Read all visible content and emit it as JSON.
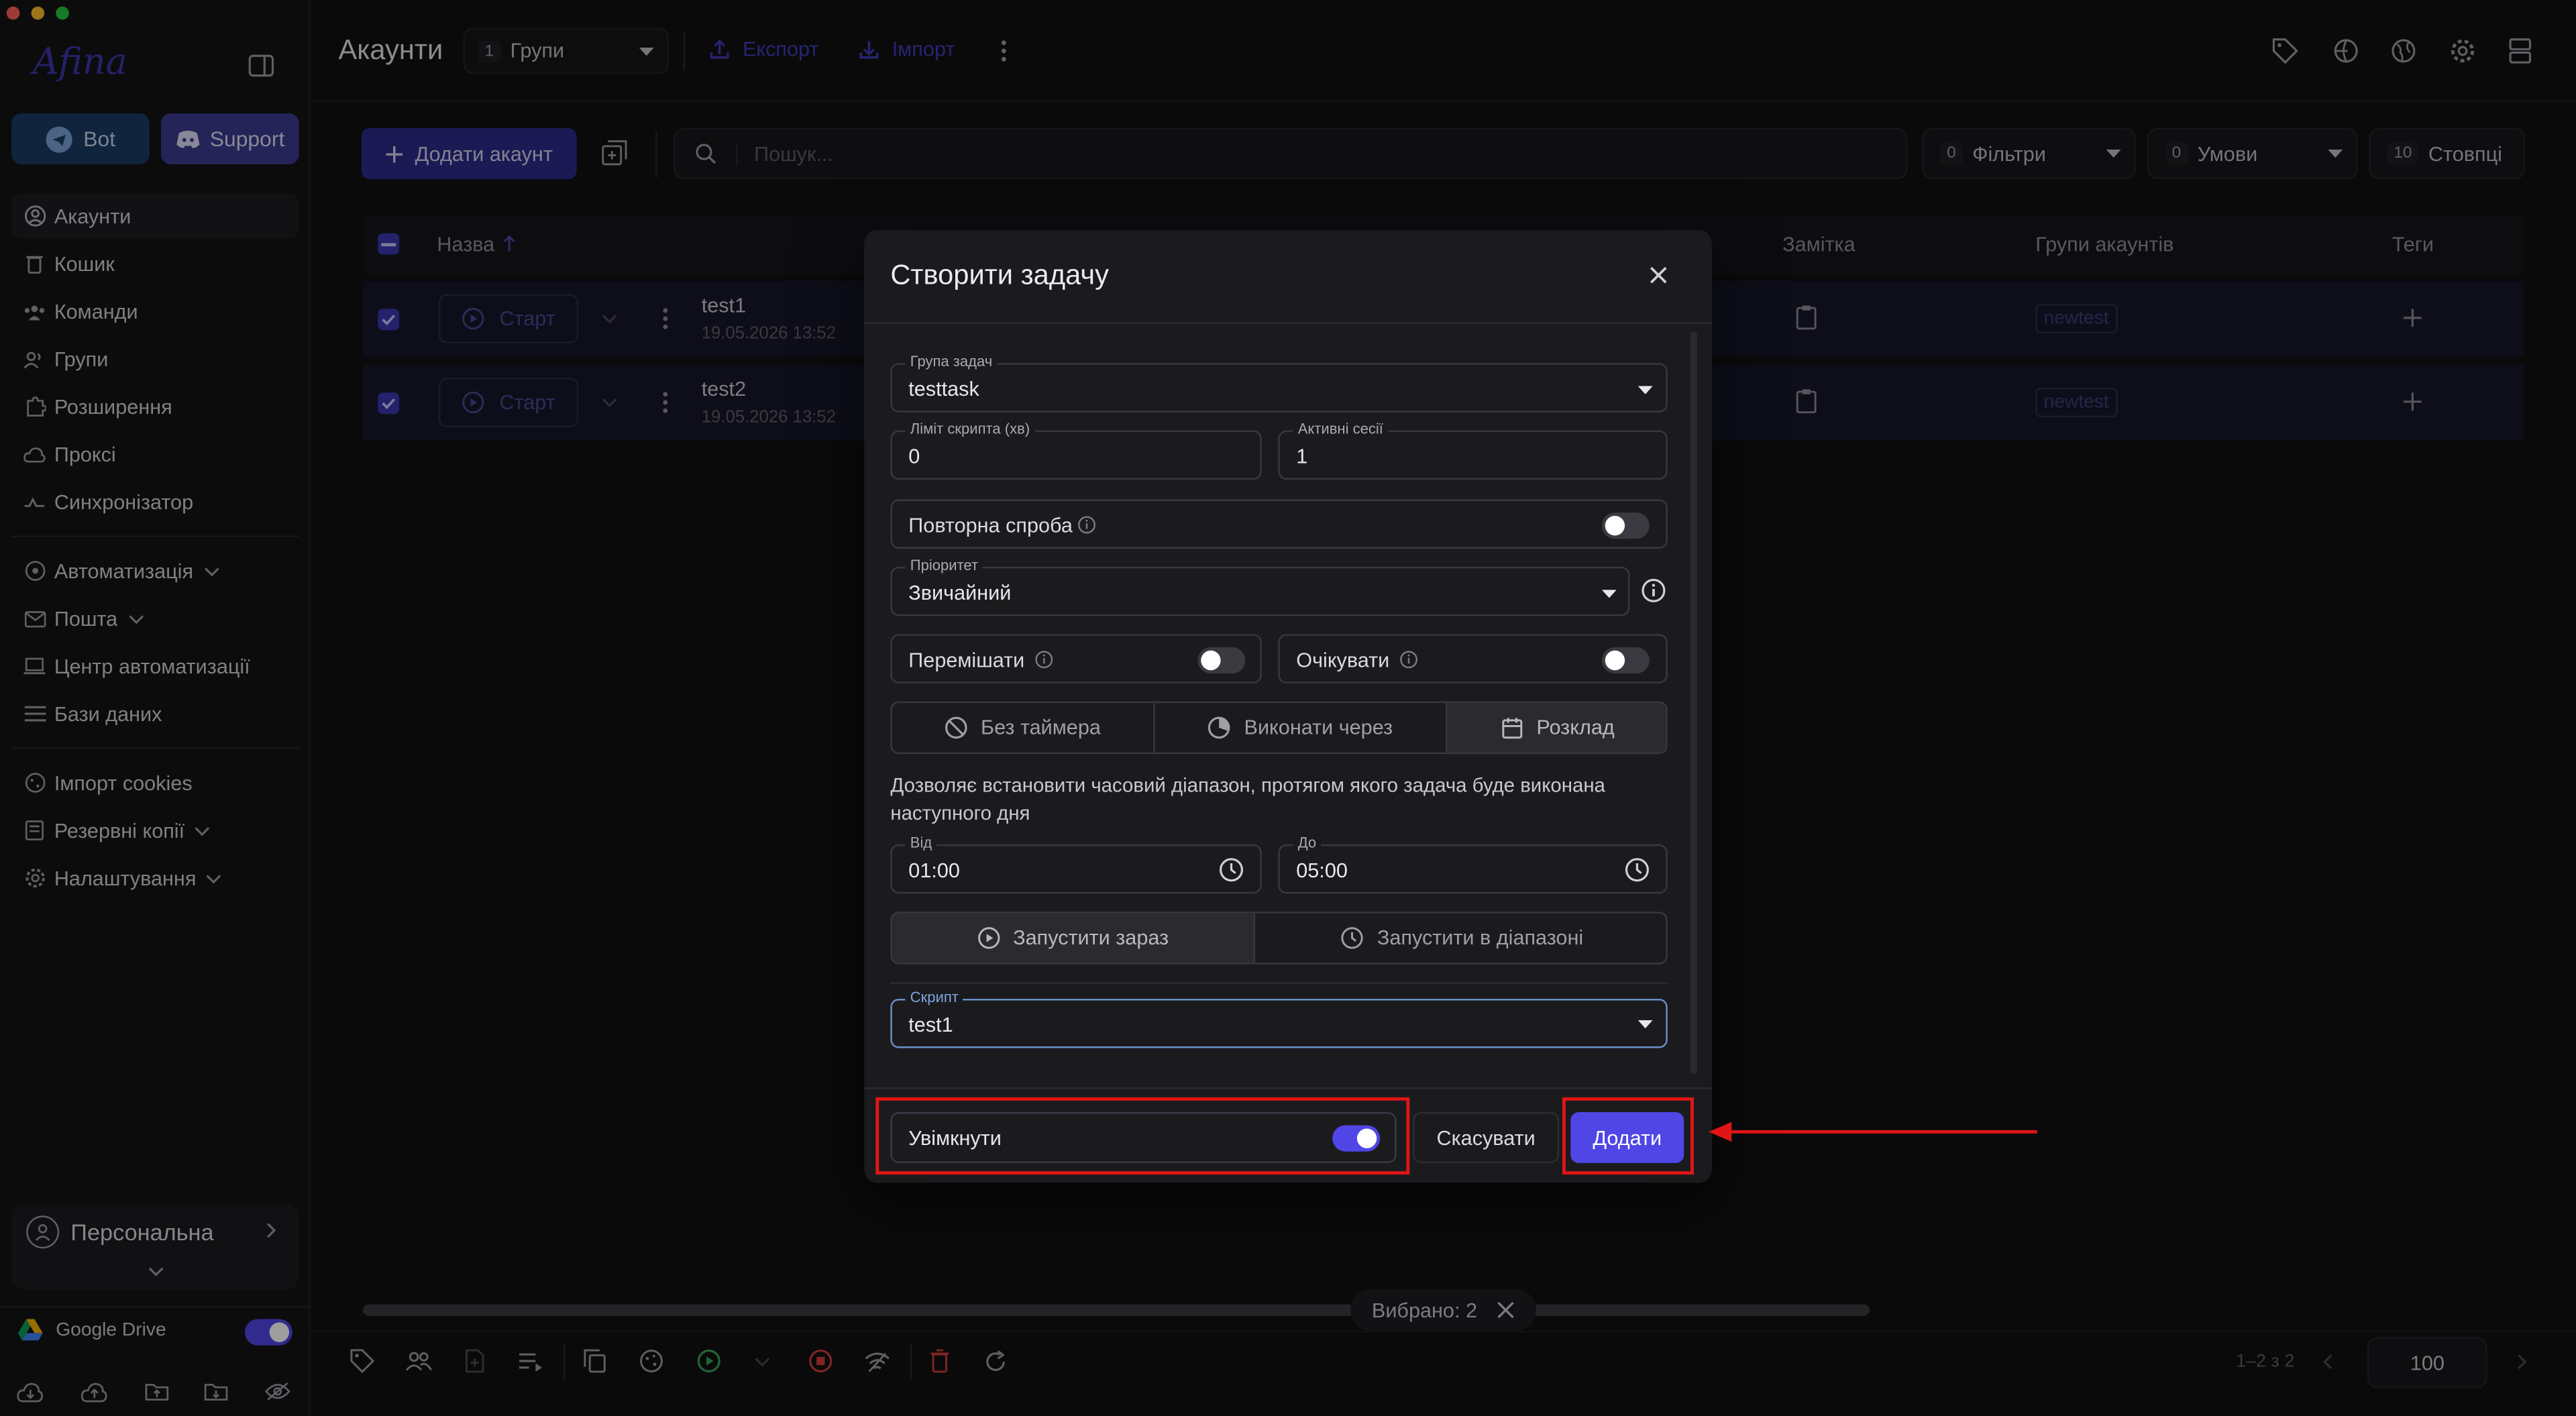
{
  "app": {
    "logo": "Afina",
    "bot_label": "Bot",
    "support_label": "Support"
  },
  "sidebar": {
    "items": [
      {
        "label": "Акаунти",
        "icon": "account-circle-icon"
      },
      {
        "label": "Кошик",
        "icon": "trash-icon"
      },
      {
        "label": "Команди",
        "icon": "team-icon"
      },
      {
        "label": "Групи",
        "icon": "group-icon"
      },
      {
        "label": "Розширення",
        "icon": "puzzle-icon"
      },
      {
        "label": "Проксі",
        "icon": "cloud-icon"
      },
      {
        "label": "Синхронізатор",
        "icon": "sync-icon"
      },
      {
        "label": "Автоматизація",
        "icon": "automation-icon"
      },
      {
        "label": "Пошта",
        "icon": "mail-icon"
      },
      {
        "label": "Центр автоматизації",
        "icon": "laptop-icon"
      },
      {
        "label": "Бази даних",
        "icon": "list-icon"
      },
      {
        "label": "Імпорт cookies",
        "icon": "cookie-icon"
      },
      {
        "label": "Резервні копії",
        "icon": "backup-icon"
      },
      {
        "label": "Налаштування",
        "icon": "gear-icon"
      }
    ],
    "profile_label": "Персональна",
    "drive_label": "Google Drive"
  },
  "topbar": {
    "title": "Акаунти",
    "groups_count": "1",
    "groups_label": "Групи",
    "export_label": "Експорт",
    "import_label": "Імпорт"
  },
  "toolbar": {
    "add_account_label": "Додати акаунт",
    "search_placeholder": "Пошук...",
    "filters_count": "0",
    "filters_label": "Фільтри",
    "conditions_count": "0",
    "conditions_label": "Умови",
    "columns_count": "10",
    "columns_label": "Стовпці"
  },
  "table": {
    "headers": {
      "name": "Назва",
      "note": "Замітка",
      "groups": "Групи акаунтів",
      "tags": "Теги"
    },
    "start_label": "Старт",
    "rows": [
      {
        "name": "test1",
        "date": "19.05.2026 13:52",
        "group": "newtest"
      },
      {
        "name": "test2",
        "date": "19.05.2026 13:52",
        "group": "newtest"
      }
    ]
  },
  "footer": {
    "selected_label": "Вибрано: 2",
    "page_info": "1–2 з 2",
    "page_size": "100"
  },
  "modal": {
    "title": "Створити задачу",
    "task_group_label": "Група задач",
    "task_group_value": "testtask",
    "script_limit_label": "Ліміт скрипта (хв)",
    "script_limit_value": "0",
    "active_sessions_label": "Активні сесії",
    "active_sessions_value": "1",
    "retry_label": "Повторна спроба",
    "priority_label": "Пріоритет",
    "priority_value": "Звичайний",
    "shuffle_label": "Перемішати",
    "wait_label": "Очікувати",
    "timer_tabs": [
      "Без таймера",
      "Виконати через",
      "Розклад"
    ],
    "schedule_desc": "Дозволяє встановити часовий діапазон, протягом якого задача буде виконана наступного дня",
    "from_label": "Від",
    "from_value": "01:00",
    "to_label": "До",
    "to_value": "05:00",
    "run_tabs": [
      "Запустити зараз",
      "Запустити в діапазоні"
    ],
    "script_label": "Скрипт",
    "script_value": "test1",
    "enable_label": "Увімкнути",
    "cancel_label": "Скасувати",
    "add_label": "Додати"
  },
  "colors": {
    "accent": "#4f46e5",
    "annotation": "#e01515",
    "background": "#111113"
  }
}
